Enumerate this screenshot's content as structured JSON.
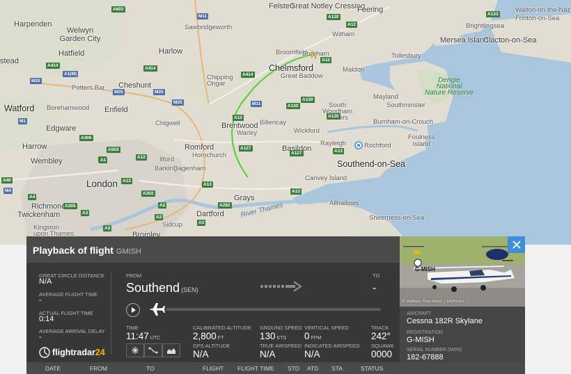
{
  "map": {
    "places": [
      {
        "id": "felsted",
        "text": "Felsted"
      },
      {
        "id": "great-notley",
        "text": "Great Notley Cressing"
      },
      {
        "id": "feering",
        "text": "Feering"
      },
      {
        "id": "walton",
        "text": "Walton-on-the-Naze"
      },
      {
        "id": "frinton",
        "text": "Frinton-on-Sea"
      },
      {
        "id": "harpenden",
        "text": "Harpenden"
      },
      {
        "id": "welwyn",
        "text": "Welwyn Garden City"
      },
      {
        "id": "sawbridgeworth",
        "text": "Sawbridgeworth"
      },
      {
        "id": "witham",
        "text": "Witham"
      },
      {
        "id": "brightlingsea",
        "text": "Brightlingsea"
      },
      {
        "id": "mersea",
        "text": "Mersea Island"
      },
      {
        "id": "clacton",
        "text": "Clacton-on-Sea"
      },
      {
        "id": "hatfield",
        "text": "Hatfield"
      },
      {
        "id": "harlow",
        "text": "Harlow"
      },
      {
        "id": "broomfield",
        "text": "Broomfield"
      },
      {
        "id": "boreham",
        "text": "Boreham"
      },
      {
        "id": "tollesbury",
        "text": "Tollesbury"
      },
      {
        "id": "stead",
        "text": "stead"
      },
      {
        "id": "chelmsford",
        "text": "Chelmsford"
      },
      {
        "id": "maldon",
        "text": "Maldon"
      },
      {
        "id": "potters-bar",
        "text": "Potters Bar"
      },
      {
        "id": "cheshunt",
        "text": "Cheshunt"
      },
      {
        "id": "chipping-ongar",
        "text": "Chipping\nOngar"
      },
      {
        "id": "great-baddow",
        "text": "Great Baddow"
      },
      {
        "id": "dengie",
        "text": "Dengie\nNational\nNature Reserve"
      },
      {
        "id": "watford",
        "text": "Watford"
      },
      {
        "id": "borehamwood",
        "text": "Borehamwood"
      },
      {
        "id": "enfield",
        "text": "Enfield"
      },
      {
        "id": "mayland",
        "text": "Mayland"
      },
      {
        "id": "south-woodham",
        "text": "South\nWoodham\nFerrers"
      },
      {
        "id": "southminster",
        "text": "Southminster"
      },
      {
        "id": "edgware",
        "text": "Edgware"
      },
      {
        "id": "chigwell",
        "text": "Chigwell"
      },
      {
        "id": "brentwood",
        "text": "Brentwood"
      },
      {
        "id": "billericay",
        "text": "Billericay"
      },
      {
        "id": "burnham",
        "text": "Burnham-on-Crouch"
      },
      {
        "id": "warley",
        "text": "Warley"
      },
      {
        "id": "wickford",
        "text": "Wickford"
      },
      {
        "id": "harrow",
        "text": "Harrow"
      },
      {
        "id": "romford",
        "text": "Romford"
      },
      {
        "id": "basildon",
        "text": "Basildon"
      },
      {
        "id": "rayleigh",
        "text": "Rayleigh"
      },
      {
        "id": "rochford",
        "text": "Rochford"
      },
      {
        "id": "foulness",
        "text": "Foulness\nIsland"
      },
      {
        "id": "hornchurch",
        "text": "Hornchurch"
      },
      {
        "id": "wembley",
        "text": "Wembley"
      },
      {
        "id": "ilford",
        "text": "Ilford"
      },
      {
        "id": "southend",
        "text": "Southend-on-Sea"
      },
      {
        "id": "barking",
        "text": "Barking"
      },
      {
        "id": "dagenham",
        "text": "Dagenham"
      },
      {
        "id": "canvey",
        "text": "Canvey Island"
      },
      {
        "id": "london",
        "text": "London"
      },
      {
        "id": "grays",
        "text": "Grays"
      },
      {
        "id": "richmond",
        "text": "Richmond"
      },
      {
        "id": "twickenham",
        "text": "Twickenham"
      },
      {
        "id": "river-thames",
        "text": "River Thames"
      },
      {
        "id": "allhallows",
        "text": "Allhallows"
      },
      {
        "id": "dartford",
        "text": "Dartford"
      },
      {
        "id": "kingston",
        "text": "Kingston\nupon Thames"
      },
      {
        "id": "sidcup",
        "text": "Sidcup"
      },
      {
        "id": "bromley",
        "text": "Bromley"
      },
      {
        "id": "sheerness",
        "text": "Sheerness-on-Sea"
      }
    ],
    "roads": [
      "A602",
      "A120",
      "A12",
      "A133",
      "M11",
      "A1(M)",
      "A414",
      "A414",
      "A414",
      "A12",
      "A130",
      "M25",
      "M25",
      "M25",
      "A130",
      "A130",
      "M25",
      "M11",
      "A12",
      "A127",
      "A13",
      "A1",
      "A406",
      "A12",
      "A13",
      "A13",
      "A202",
      "A2",
      "A282",
      "A2",
      "M1",
      "M4",
      "A4",
      "A205",
      "A3",
      "A3",
      "A2",
      "A13",
      "A40",
      "A503",
      "A127",
      "A1"
    ]
  },
  "panel": {
    "title": "Playback of flight",
    "callsign": "GMISH",
    "great_circle_label": "GREAT CIRCLE DISTANCE",
    "great_circle_value": "N/A",
    "avg_flight_time_label": "AVERAGE FLIGHT TIME",
    "avg_flight_time_value": "-",
    "actual_flight_time_label": "ACTUAL FLIGHT TIME",
    "actual_flight_time_value": "0:14",
    "avg_arrival_delay_label": "AVERAGE ARRIVAL DELAY",
    "avg_arrival_delay_value": "-",
    "from_label": "FROM",
    "from_city": "Southend",
    "from_code": "(SEN)",
    "to_label": "TO",
    "to_city": "-",
    "time_label": "TIME",
    "time_value": "11:47",
    "time_unit": "UTC",
    "cal_alt_label": "CALIBRATED ALTITUDE",
    "cal_alt_value": "2,800",
    "cal_alt_unit": "FT",
    "gps_alt_label": "GPS ALTITUDE",
    "gps_alt_value": "N/A",
    "ground_speed_label": "GROUND SPEED",
    "ground_speed_value": "130",
    "ground_speed_unit": "KTS",
    "true_airspeed_label": "TRUE AIRSPEED",
    "true_airspeed_value": "N/A",
    "vertical_speed_label": "VERTICAL SPEED",
    "vertical_speed_value": "0",
    "vertical_speed_unit": "FPM",
    "indicated_airspeed_label": "INDICATED AIRSPEED",
    "indicated_airspeed_value": "N/A",
    "track_label": "TRACK",
    "track_value": "242°",
    "squawk_label": "SQUAWK",
    "squawk_value": "0000",
    "logo_text": "flightradar",
    "logo_num": "24"
  },
  "aircraft": {
    "photo_credit": "© Wallace Shackleton | Jetphotos",
    "photo_registration": "G-MISH",
    "aircraft_label": "AIRCRAFT",
    "aircraft_value": "Cessna 182R Skylane",
    "registration_label": "REGISTRATION",
    "registration_value": "G-MISH",
    "serial_label": "SERIAL NUMBER (MSN)",
    "serial_value": "182-67888"
  },
  "table": {
    "columns": [
      "DATE",
      "FROM",
      "TO",
      "FLIGHT",
      "FLIGHT TIME",
      "STD",
      "ATD",
      "STA",
      "STATUS"
    ]
  },
  "colors": {
    "track": "#4cd137",
    "sea": "#aac6dd",
    "land": "#e2ddd3",
    "panel_bg": "#373737",
    "accent": "#3f8ed8",
    "logo_accent": "#f5b300"
  }
}
